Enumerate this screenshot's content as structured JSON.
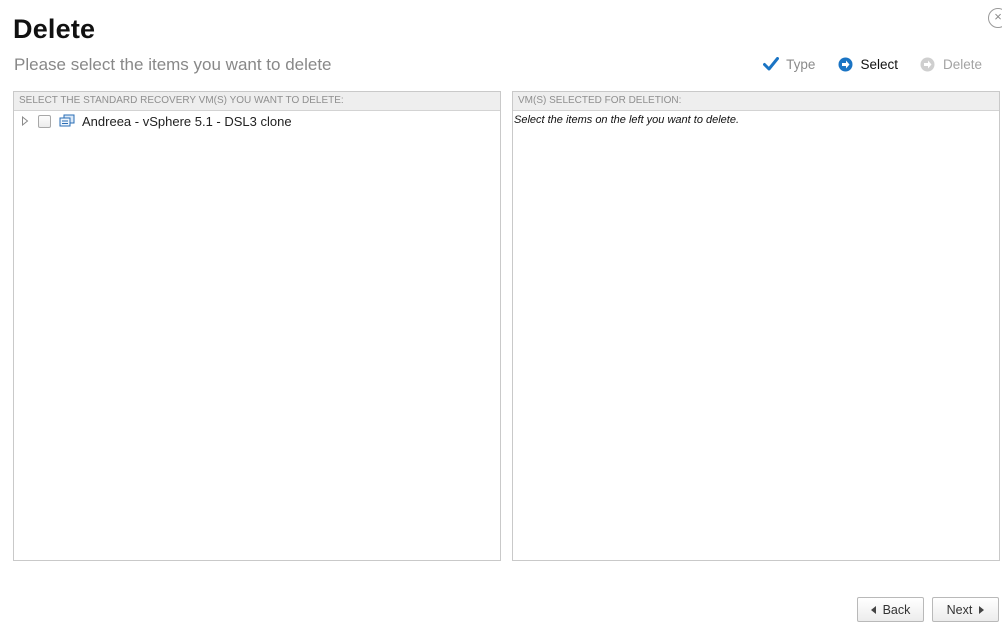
{
  "dialog": {
    "title": "Delete",
    "subtitle": "Please select the items you want to delete",
    "close_glyph": "×"
  },
  "wizard_steps": [
    {
      "label": "Type",
      "state": "completed",
      "icon": "checkmark-icon"
    },
    {
      "label": "Select",
      "state": "current",
      "icon": "arrow-circle-icon"
    },
    {
      "label": "Delete",
      "state": "pending",
      "icon": "arrow-circle-icon"
    }
  ],
  "left_panel": {
    "header": "SELECT THE STANDARD RECOVERY VM(S) YOU WANT TO DELETE:",
    "items": [
      {
        "label": "Andreea - vSphere 5.1 - DSL3 clone",
        "checked": false,
        "expanded": false,
        "icon": "vm-icon"
      }
    ]
  },
  "right_panel": {
    "header": "VM(S) SELECTED FOR DELETION:",
    "hint": "Select the items on the left you want to delete."
  },
  "footer": {
    "back_label": "Back",
    "next_label": "Next"
  },
  "colors": {
    "accent_blue": "#1a74c4",
    "step_done_gray": "#8a8a8a",
    "step_pending_gray": "#c4c4c4"
  }
}
